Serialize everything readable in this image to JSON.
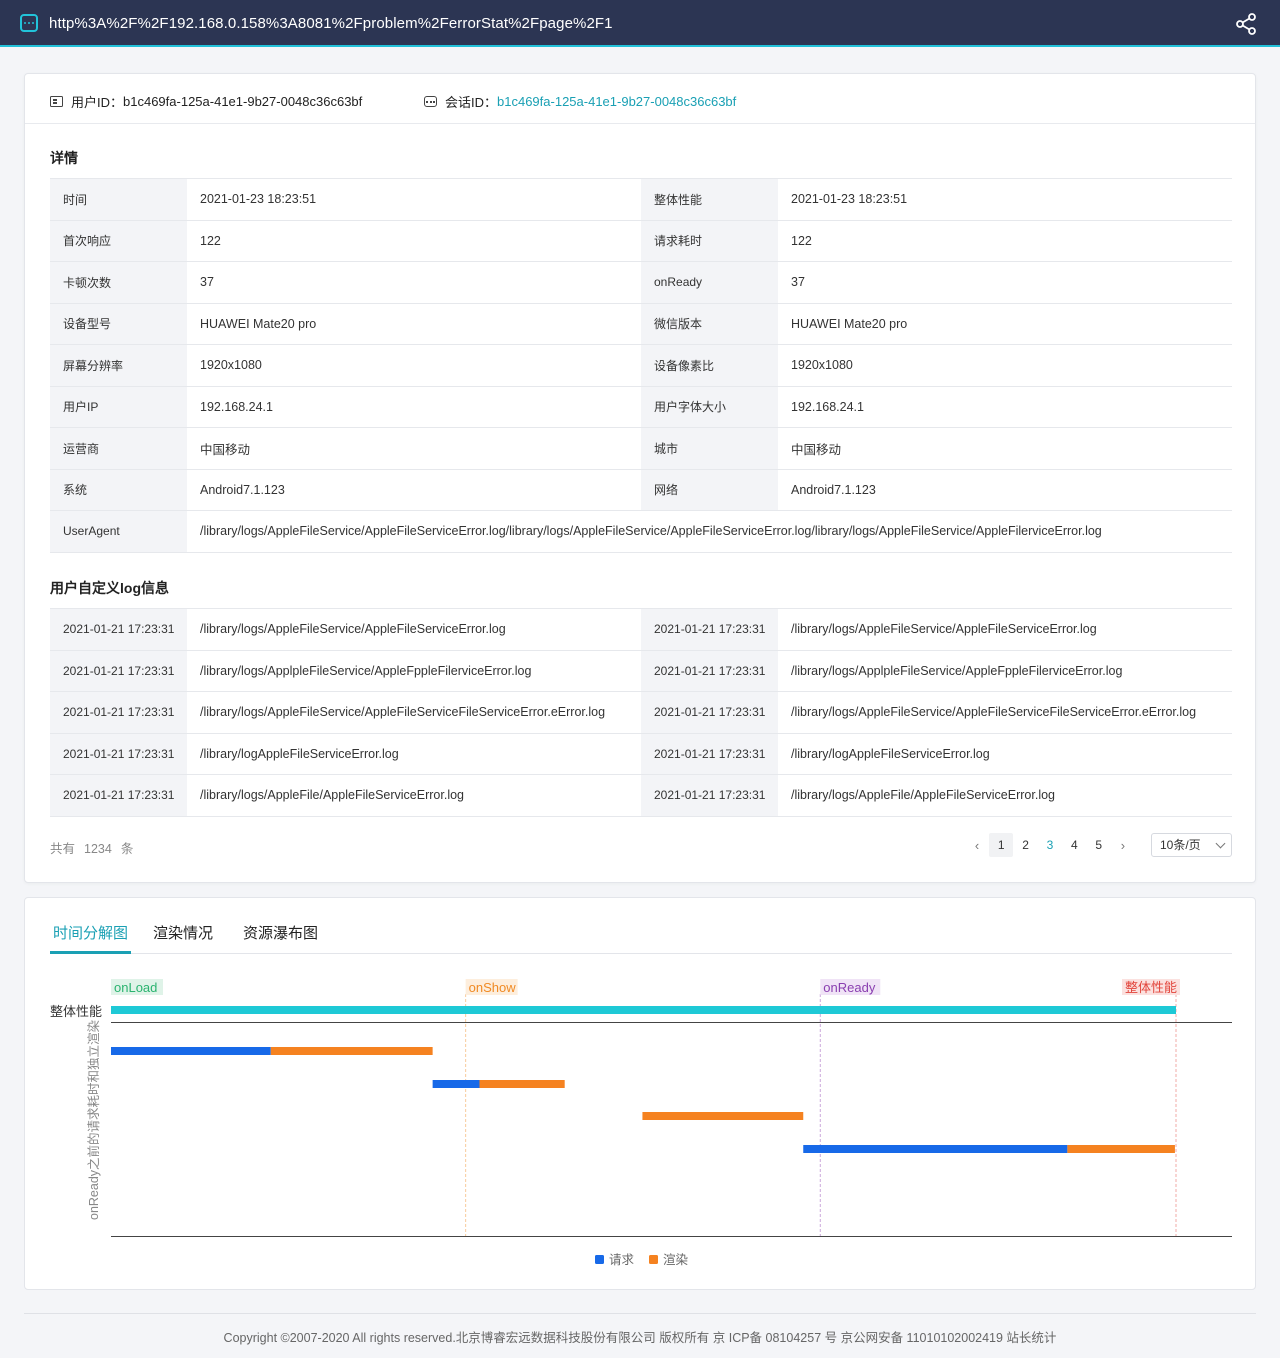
{
  "topbar": {
    "url": "http%3A%2F%2F192.168.0.158%3A8081%2Fproblem%2FerrorStat%2Fpage%2F1",
    "app_icon": "app-chat-icon",
    "share_icon": "share-icon"
  },
  "ids": {
    "user_label": "用户ID：",
    "user_value": "b1c469fa-125a-41e1-9b27-0048c36c63bf",
    "session_label": "会话ID：",
    "session_value": "b1c469fa-125a-41e1-9b27-0048c36c63bf"
  },
  "details": {
    "title": "详情",
    "rows": [
      {
        "k1": "时间",
        "v1": "2021-01-23  18:23:51",
        "k2": "整体性能",
        "v2": "2021-01-23  18:23:51"
      },
      {
        "k1": "首次响应",
        "v1": "122",
        "k2": "请求耗时",
        "v2": "122"
      },
      {
        "k1": "卡顿次数",
        "v1": "37",
        "k2": "onReady",
        "v2": "37"
      },
      {
        "k1": "设备型号",
        "v1": "HUAWEI Mate20 pro",
        "k2": "微信版本",
        "v2": "HUAWEI Mate20 pro"
      },
      {
        "k1": "屏幕分辨率",
        "v1": "1920x1080",
        "k2": "设备像素比",
        "v2": "1920x1080"
      },
      {
        "k1": "用户IP",
        "v1": "192.168.24.1",
        "k2": "用户字体大小",
        "v2": "192.168.24.1"
      },
      {
        "k1": "运营商",
        "v1": "中国移动",
        "k2": "城市",
        "v2": "中国移动"
      },
      {
        "k1": "系统",
        "v1": "Android7.1.123",
        "k2": "网络",
        "v2": "Android7.1.123"
      }
    ],
    "ua_label": "UserAgent",
    "ua_value": "/library/logs/AppleFileService/AppleFileServiceError.log/library/logs/AppleFileService/AppleFileServiceError.log/library/logs/AppleFileService/AppleFilerviceError.log"
  },
  "logs": {
    "title": "用户自定义log信息",
    "rows": [
      {
        "t1": "2021-01-21  17:23:31",
        "m1": "/library/logs/AppleFileService/AppleFileServiceError.log",
        "t2": "2021-01-21  17:23:31",
        "m2": "/library/logs/AppleFileService/AppleFileServiceError.log"
      },
      {
        "t1": "2021-01-21  17:23:31",
        "m1": "/library/logs/ApplpleFileService/AppleFppleFilerviceError.log",
        "t2": "2021-01-21  17:23:31",
        "m2": "/library/logs/ApplpleFileService/AppleFppleFilerviceError.log"
      },
      {
        "t1": "2021-01-21  17:23:31",
        "m1": "/library/logs/AppleFileService/AppleFileServiceFileServiceError.eError.log",
        "t2": "2021-01-21  17:23:31",
        "m2": "/library/logs/AppleFileService/AppleFileServiceFileServiceError.eError.log"
      },
      {
        "t1": "2021-01-21  17:23:31",
        "m1": "/library/logAppleFileServiceError.log",
        "t2": "2021-01-21  17:23:31",
        "m2": "/library/logAppleFileServiceError.log"
      },
      {
        "t1": "2021-01-21  17:23:31",
        "m1": "/library/logs/AppleFile/AppleFileServiceError.log",
        "t2": "2021-01-21  17:23:31",
        "m2": "/library/logs/AppleFile/AppleFileServiceError.log"
      }
    ],
    "total_prefix": "共有",
    "total_count": "1234",
    "total_suffix": "条",
    "pages": [
      "1",
      "2",
      "3",
      "4",
      "5"
    ],
    "current_page": "1",
    "page_size": "10条/页"
  },
  "tabs": [
    "时间分解图",
    "渲染情况",
    "资源瀑布图"
  ],
  "chart_data": {
    "type": "bar",
    "subtype": "timeline",
    "x_range": [
      0,
      1000
    ],
    "markers": [
      {
        "label": "onLoad",
        "x": 0,
        "color": "#2ab36f",
        "bg": "#dff3e8"
      },
      {
        "label": "onShow",
        "x": 333,
        "color": "#f08a24",
        "bg": "#fdeedd"
      },
      {
        "label": "onReady",
        "x": 666,
        "color": "#8a3fb0",
        "bg": "#f0e3f6"
      },
      {
        "label": "整体性能",
        "x": 1000,
        "color": "#e2453c",
        "bg": "#fbe1df"
      }
    ],
    "overall": {
      "label": "整体性能",
      "start": 0,
      "end": 1000,
      "color": "#1ec9d6"
    },
    "ylabel": "onReady之前的请求耗时和独立渲染",
    "rows": [
      [
        {
          "series": "请求",
          "start": 0,
          "end": 150
        },
        {
          "series": "渲染",
          "start": 150,
          "end": 302
        }
      ],
      [
        {
          "series": "请求",
          "start": 302,
          "end": 346
        },
        {
          "series": "渲染",
          "start": 346,
          "end": 426
        }
      ],
      [
        {
          "series": "渲染",
          "start": 499,
          "end": 650
        }
      ],
      [
        {
          "series": "请求",
          "start": 650,
          "end": 898
        },
        {
          "series": "渲染",
          "start": 898,
          "end": 999
        }
      ]
    ],
    "series": [
      {
        "name": "请求",
        "color": "#1769e8"
      },
      {
        "name": "渲染",
        "color": "#f58220"
      }
    ]
  },
  "footer": "Copyright ©2007-2020 All rights reserved.北京博睿宏远数据科技股份有限公司 版权所有 京 ICP备 08104257 号 京公网安备 11010102002419 站长统计"
}
